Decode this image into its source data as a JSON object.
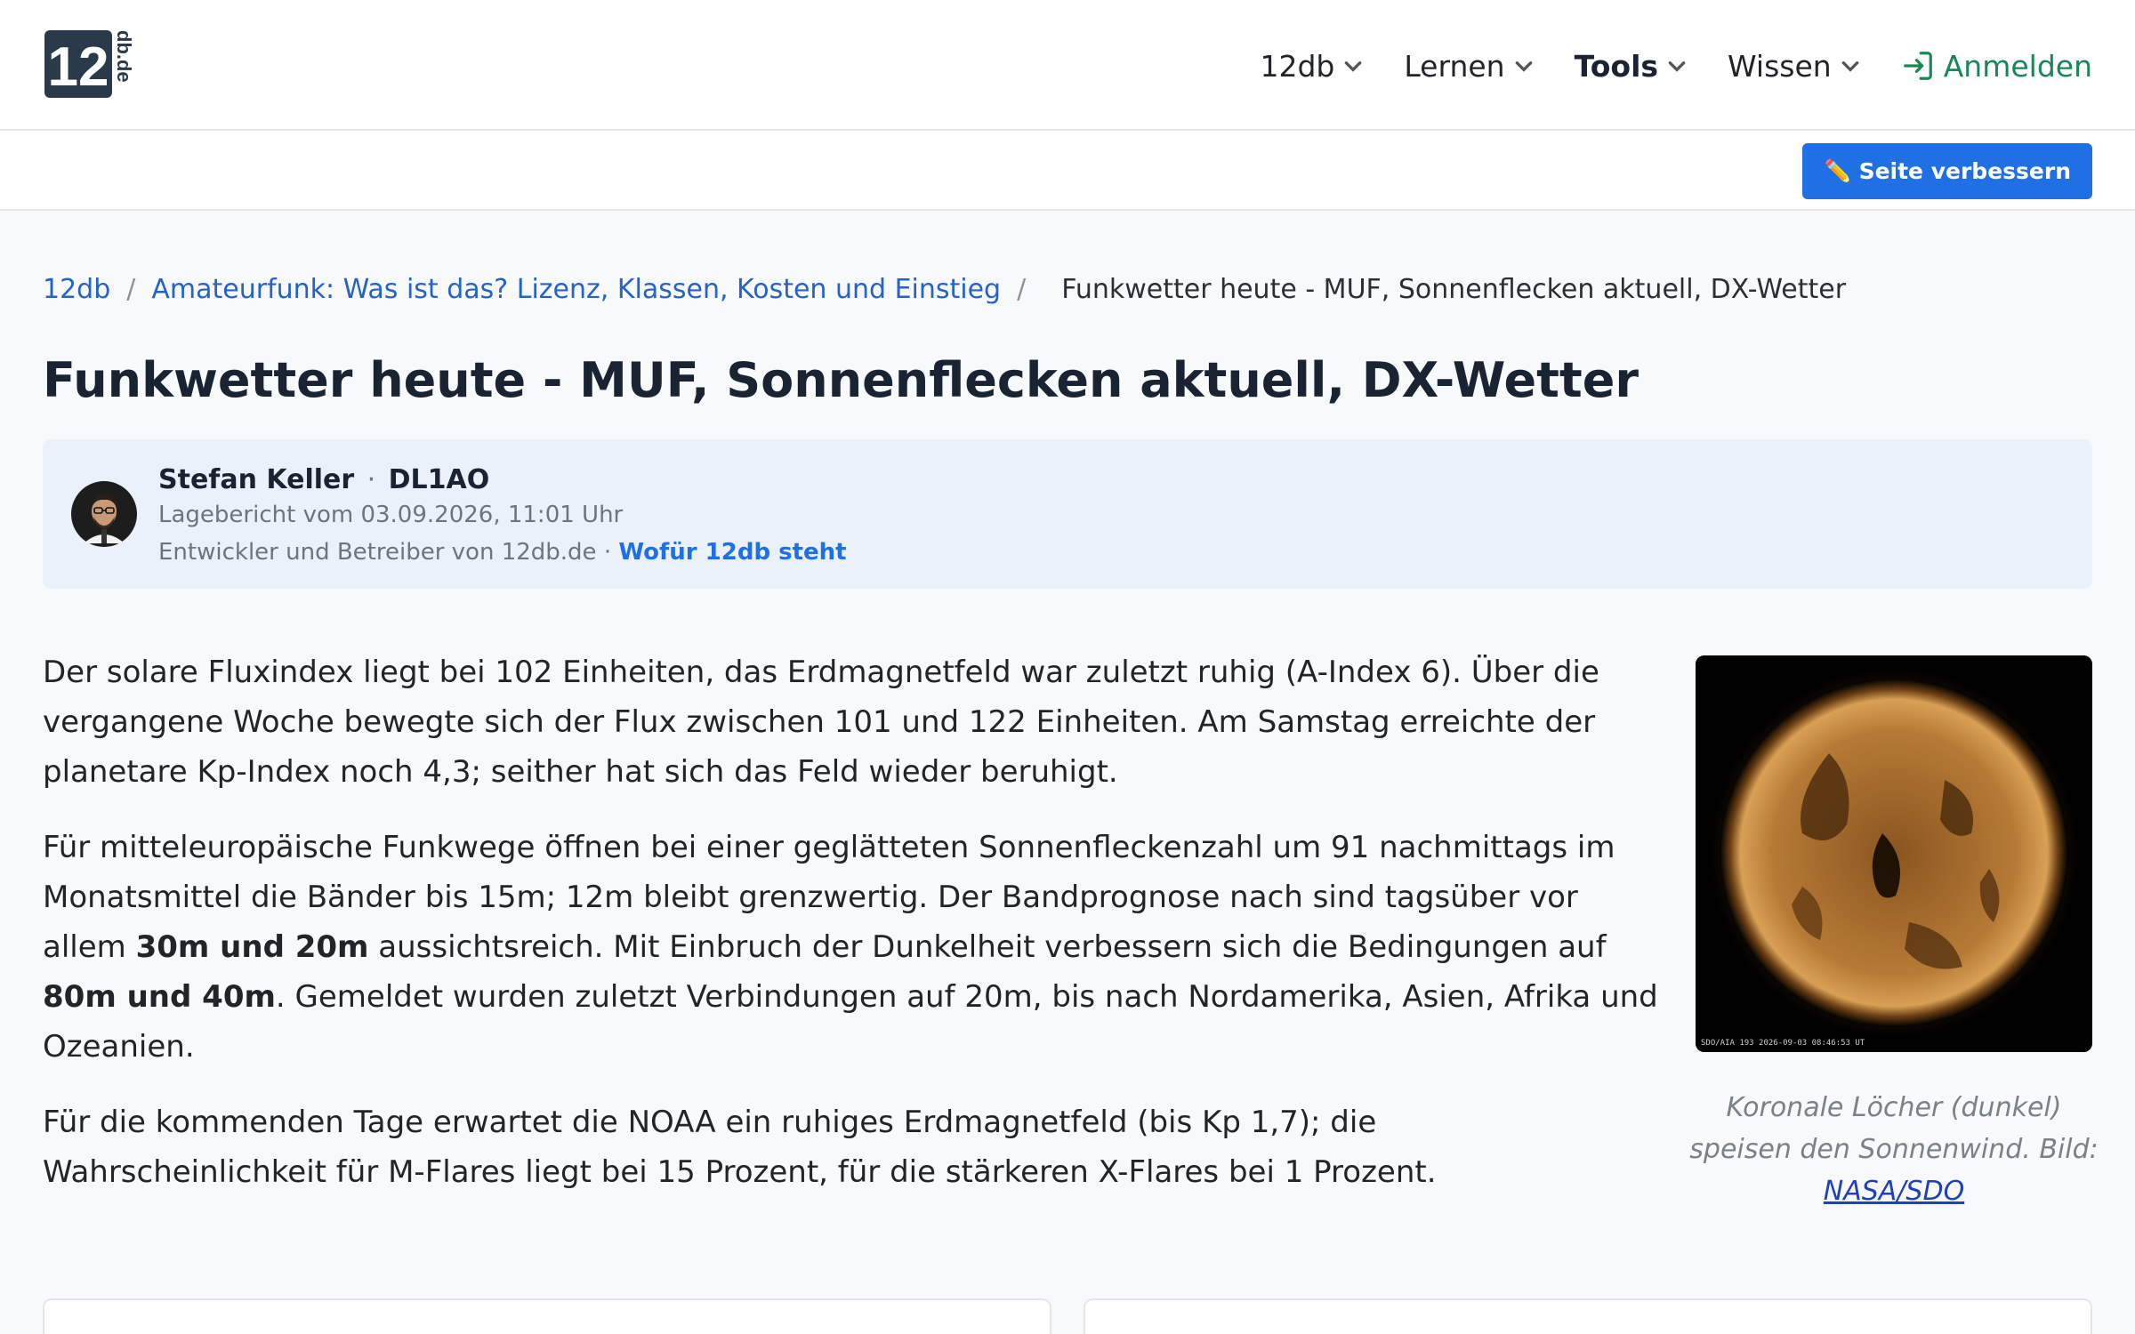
{
  "logo": {
    "number": "12",
    "domain": "db.de"
  },
  "nav": {
    "items": [
      {
        "label": "12db"
      },
      {
        "label": "Lernen"
      },
      {
        "label": "Tools"
      },
      {
        "label": "Wissen"
      }
    ],
    "login_label": "Anmelden"
  },
  "subbar": {
    "improve_label": "Seite verbessern",
    "improve_icon": "✏️"
  },
  "breadcrumb": {
    "items": [
      "12db",
      "Amateurfunk: Was ist das? Lizenz, Klassen, Kosten und Einstieg"
    ],
    "separator": "/",
    "current": "Funkwetter heute - MUF, Sonnenflecken aktuell, DX-Wetter"
  },
  "page_title": "Funkwetter heute - MUF, Sonnenflecken aktuell, DX-Wetter",
  "author": {
    "name": "Stefan Keller",
    "separator": "·",
    "callsign": "DL1AO",
    "date": "Lagebericht vom 03.09.2026, 11:01 Uhr",
    "role": "Entwickler und Betreiber von 12db.de ·",
    "link": "Wofür 12db steht"
  },
  "article": {
    "p1": "Der solare Fluxindex liegt bei 102 Einheiten, das Erdmagnetfeld war zuletzt ruhig (A-Index 6). Über die vergangene Woche bewegte sich der Flux zwischen 101 und 122 Einheiten. Am Samstag erreichte der planetare Kp-Index noch 4,3; seither hat sich das Feld wieder beruhigt.",
    "p2_a": "Für mitteleuropäische Funkwege öffnen bei einer geglätteten Sonnenfleckenzahl um 91 nachmittags im Monatsmittel die Bänder bis 15m; 12m bleibt grenzwertig. Der Bandprognose nach sind tagsüber vor allem ",
    "p2_b": "30m und 20m",
    "p2_c": " aussichtsreich. Mit Einbruch der Dunkelheit verbessern sich die Bedingungen auf ",
    "p2_d": "80m und 40m",
    "p2_e": ". Gemeldet wurden zuletzt Verbindungen auf 20m, bis nach Nordamerika, Asien, Afrika und Ozeanien.",
    "p3": "Für die kommenden Tage erwartet die NOAA ein ruhiges Erdmagnetfeld (bis Kp 1,7); die Wahrscheinlichkeit für M-Flares liegt bei 15 Prozent, für die stärkeren X-Flares bei 1 Prozent."
  },
  "figure": {
    "image_label": "SDO/AIA 193    2026-09-03 08:46:53 UT",
    "caption_text": "Koronale Löcher (dunkel) speisen den Sonnenwind. Bild:",
    "caption_link": "NASA/SDO"
  },
  "colors": {
    "accent": "#1f6fe5",
    "login": "#198754",
    "title": "#1a2332"
  }
}
